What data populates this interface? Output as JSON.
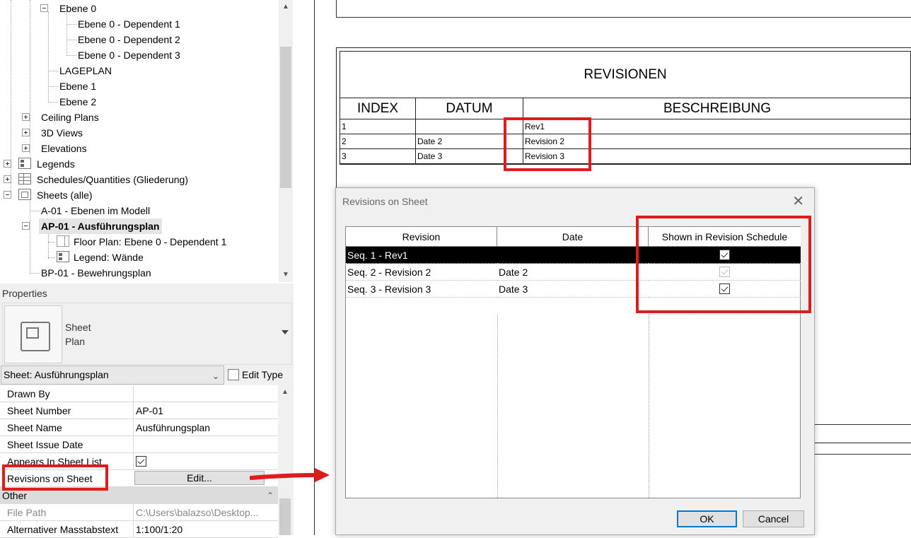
{
  "browser": {
    "items": [
      {
        "label": "Ebene 0"
      },
      {
        "label": "Ebene 0 - Dependent 1"
      },
      {
        "label": "Ebene 0 - Dependent 2"
      },
      {
        "label": "Ebene 0 - Dependent 3"
      },
      {
        "label": "LAGEPLAN"
      },
      {
        "label": "Ebene 1"
      },
      {
        "label": "Ebene 2"
      },
      {
        "label": "Ceiling Plans"
      },
      {
        "label": "3D Views"
      },
      {
        "label": "Elevations"
      },
      {
        "label": "Legends"
      },
      {
        "label": "Schedules/Quantities (Gliederung)"
      },
      {
        "label": "Sheets (alle)"
      },
      {
        "label": "A-01 - Ebenen im Modell"
      },
      {
        "label": "AP-01 - Ausführungsplan"
      },
      {
        "label": "Floor Plan: Ebene 0 - Dependent 1"
      },
      {
        "label": "Legend: Wände"
      },
      {
        "label": "BP-01 - Bewehrungsplan"
      }
    ]
  },
  "properties": {
    "title": "Properties",
    "type_name_line1": "Sheet",
    "type_name_line2": "Plan",
    "instance_selector": "Sheet: Ausführungsplan",
    "edit_type": "Edit Type",
    "rows": [
      {
        "name": "Drawn By",
        "value": ""
      },
      {
        "name": "Sheet Number",
        "value": "AP-01"
      },
      {
        "name": "Sheet Name",
        "value": "Ausführungsplan"
      },
      {
        "name": "Sheet Issue Date",
        "value": ""
      },
      {
        "name": "Appears In Sheet List",
        "value": ""
      },
      {
        "name": "Revisions on Sheet",
        "value": "Edit..."
      }
    ],
    "group_other": "Other",
    "other_rows": [
      {
        "name": "File Path",
        "value": "C:\\Users\\balazso\\Desktop..."
      },
      {
        "name": "Alternativer Masstabstext",
        "value": "1:100/1:20"
      }
    ]
  },
  "schedule": {
    "title": "REVISIONEN",
    "headers": [
      "INDEX",
      "DATUM",
      "BESCHREIBUNG"
    ],
    "rows": [
      {
        "index": "1",
        "date": "",
        "desc": "Rev1"
      },
      {
        "index": "2",
        "date": "Date 2",
        "desc": "Revision 2"
      },
      {
        "index": "3",
        "date": "Date 3",
        "desc": "Revision 3"
      }
    ]
  },
  "dialog": {
    "title": "Revisions on Sheet",
    "headers": [
      "Revision",
      "Date",
      "Shown in Revision Schedule"
    ],
    "rows": [
      {
        "revision": "Seq. 1 - Rev1",
        "date": "",
        "shown": true,
        "selected": true
      },
      {
        "revision": "Seq. 2 - Revision 2",
        "date": "Date 2",
        "shown": true,
        "selected": false
      },
      {
        "revision": "Seq. 3 - Revision 3",
        "date": "Date 3",
        "shown": true,
        "selected": false
      }
    ],
    "ok": "OK",
    "cancel": "Cancel"
  },
  "colors": {
    "annotation_red": "#e01b1b",
    "selection": "#000000",
    "focus_blue": "#0078d7"
  }
}
